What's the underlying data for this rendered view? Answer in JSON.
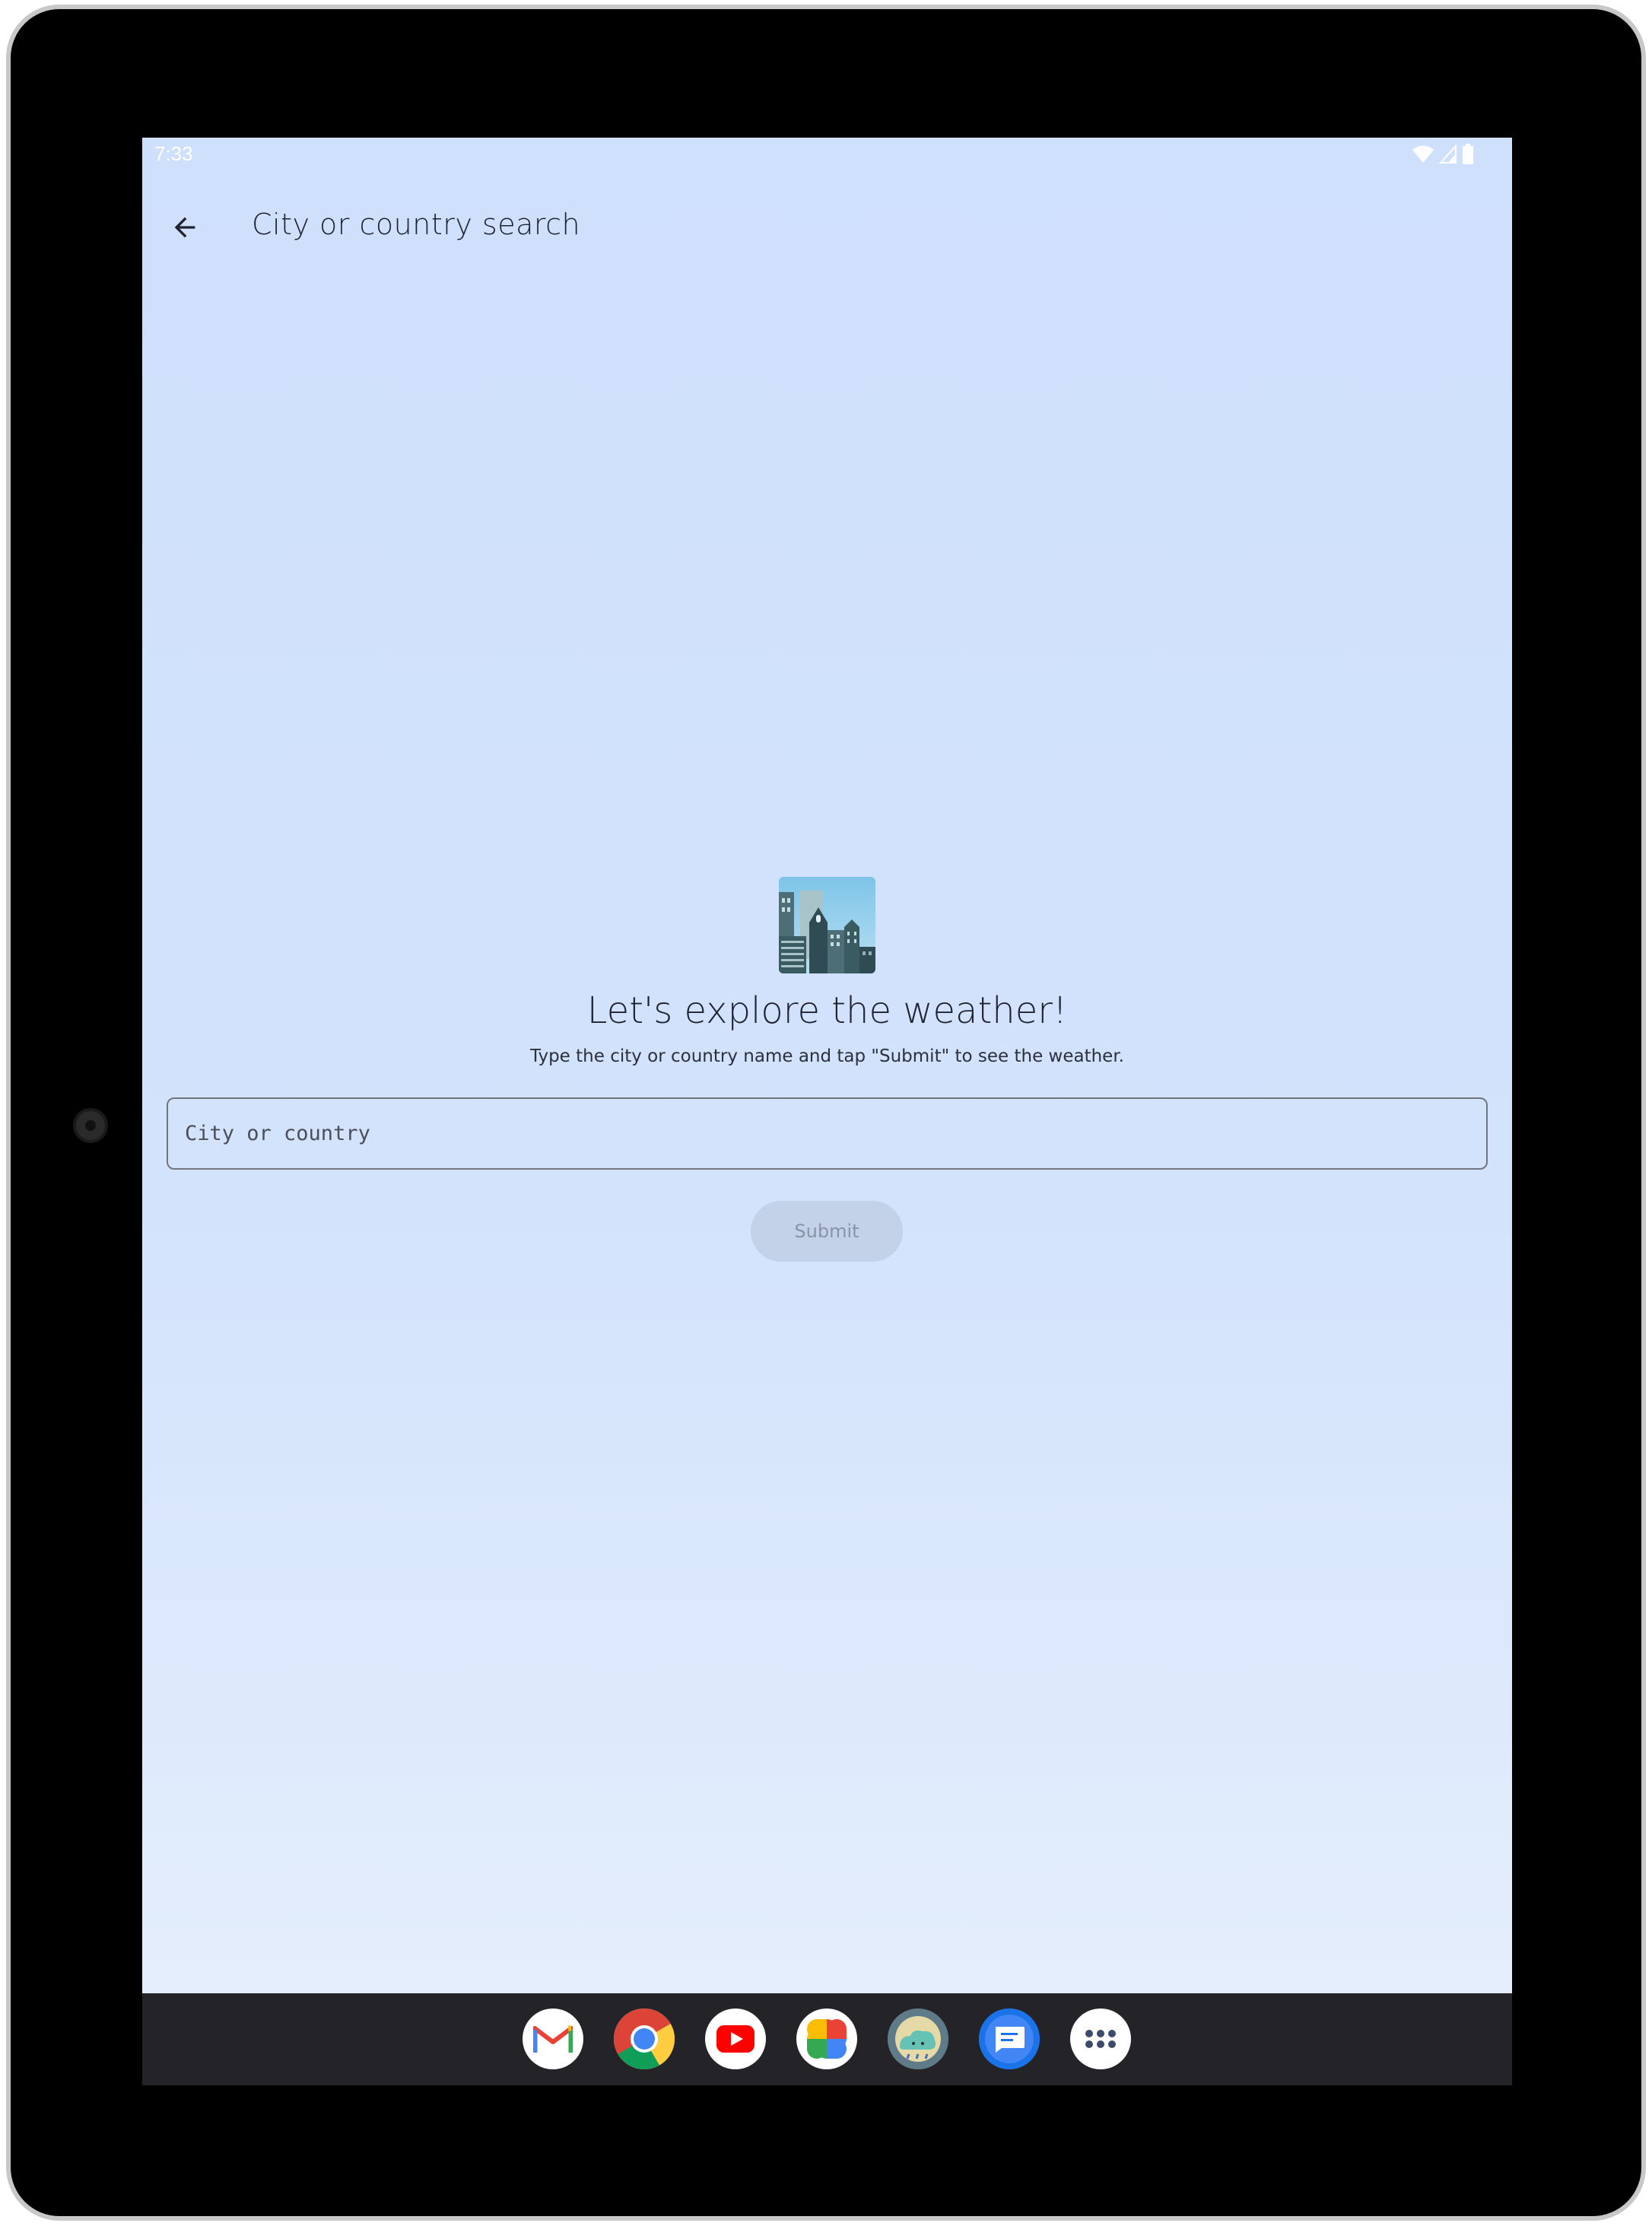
{
  "status_bar": {
    "time": "7:33"
  },
  "app_bar": {
    "back_icon": "arrow-left-icon",
    "title": "City or country search"
  },
  "hero": {
    "image_icon": "cityscape-icon",
    "headline": "Let's explore the weather!",
    "subline": "Type the city or country name and tap \"Submit\" to see the weather."
  },
  "search": {
    "value": "",
    "placeholder": "City or country"
  },
  "submit": {
    "label": "Submit"
  },
  "dock": {
    "apps": [
      "gmail-icon",
      "chrome-icon",
      "youtube-icon",
      "photos-icon",
      "weather-app-icon",
      "messages-icon",
      "app-drawer-icon"
    ]
  },
  "colors": {
    "screen_bg_top": "#cfe0fc",
    "screen_bg_bottom": "#e6effc",
    "text_primary": "#1f2230",
    "submit_disabled_bg": "#c3d1e9",
    "nav_bar": "#242428"
  }
}
